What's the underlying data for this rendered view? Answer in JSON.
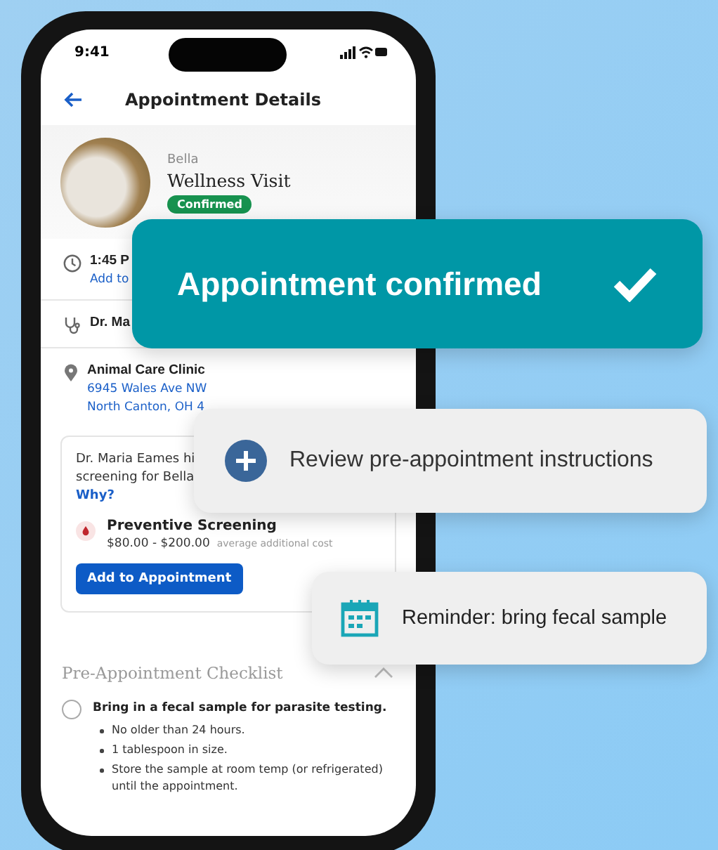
{
  "status_bar": {
    "time": "9:41"
  },
  "header": {
    "title": "Appointment Details"
  },
  "pet": {
    "name": "Bella",
    "visit": "Wellness Visit",
    "status": "Confirmed"
  },
  "details": [
    {
      "kind": "time",
      "text": "1:45 P",
      "link": "Add to"
    },
    {
      "kind": "doctor",
      "text": "Dr. Ma"
    },
    {
      "kind": "location",
      "text": "Animal Care Clinic",
      "lines": [
        "6945 Wales Ave NW",
        "North Canton, OH 4"
      ]
    }
  ],
  "recommendation": {
    "lines": [
      "Dr. Maria Eames hi",
      "screening for Bella"
    ],
    "link": "Why?",
    "service": "Preventive Screening",
    "price": "$80.00 - $200.00",
    "price_note": "average additional cost",
    "button": "Add to Appointment"
  },
  "checklist": {
    "title": "Pre-Appointment Checklist",
    "expanded": true,
    "items": [
      {
        "text": "Bring in a fecal sample for parasite testing.",
        "checked": false,
        "notes": [
          "No older than 24 hours.",
          "1 tablespoon in size.",
          "Store the sample at room temp (or refrigerated) until the appointment."
        ]
      }
    ]
  },
  "callouts": [
    {
      "kind": "confirmed",
      "text": "Appointment confirmed"
    },
    {
      "kind": "instructions",
      "text": "Review pre-appointment instructions"
    },
    {
      "kind": "reminder",
      "text": "Reminder: bring fecal sample"
    }
  ]
}
